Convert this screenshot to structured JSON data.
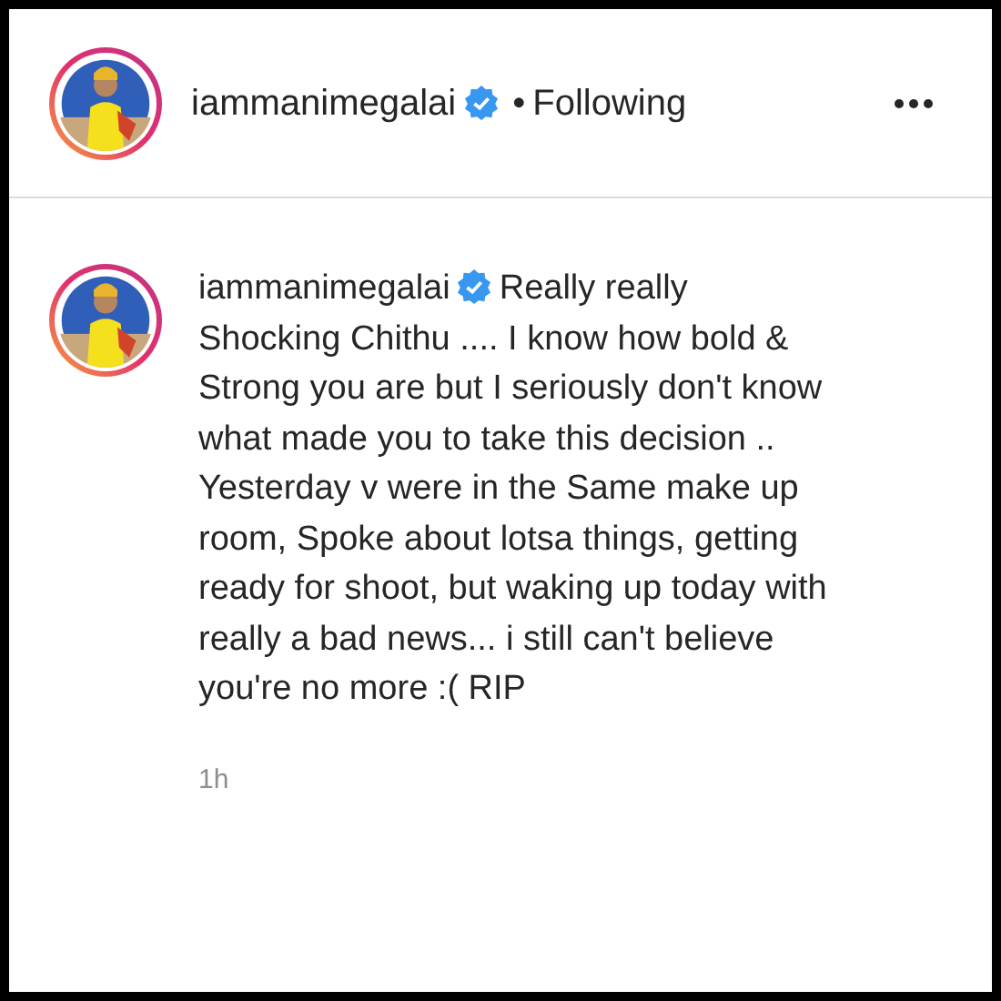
{
  "post_header": {
    "username": "iammanimegalai",
    "verified": true,
    "separator": "•",
    "follow_status": "Following"
  },
  "comment": {
    "username": "iammanimegalai",
    "verified": true,
    "text": "Really really Shocking Chithu .... I know how bold & Strong you are but I seriously don't know what made you to take this decision .. Yesterday v were in the Same make up room, Spoke about lotsa things, getting ready for shoot, but waking up today with really a bad news... i still can't believe you're no more :( RIP",
    "time": "1h"
  }
}
